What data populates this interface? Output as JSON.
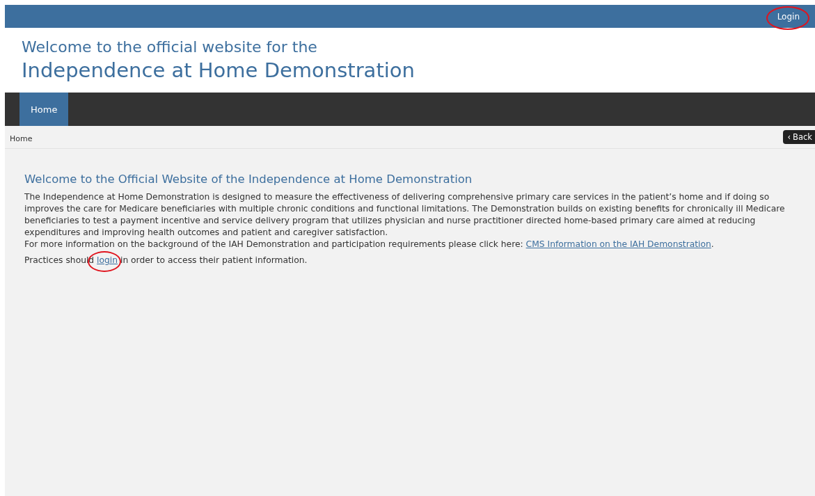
{
  "top_bar": {
    "login": {
      "label": "Login",
      "annotated": true
    }
  },
  "header": {
    "subtitle": "Welcome to the official website for the",
    "title": "Independence at Home Demonstration"
  },
  "nav": {
    "tabs": [
      {
        "label": "Home",
        "selected": true
      }
    ]
  },
  "breadcrumb": {
    "items": [
      "Home"
    ],
    "back": {
      "icon": "‹",
      "label": "Back"
    }
  },
  "content": {
    "heading": "Welcome to the Official Website of the Independence at Home Demonstration",
    "paragraphs": [
      {
        "lines": [
          [
            {
              "kind": "text",
              "text": "The Independence at Home Demonstration is designed to measure the effectiveness of delivering comprehensive primary care services in the patient’s home and if doing so improves the care for Medicare beneficiaries with multiple chronic conditions and functional limitations. The Demonstration builds on existing benefits for chronically ill Medicare beneficiaries to test a payment incentive and service delivery program that utilizes physician and nurse practitioner directed home-based primary care aimed at reducing expenditures and improving health outcomes and patient and caregiver satisfaction."
            }
          ],
          [
            {
              "kind": "text",
              "text": "For more information on the background of the IAH Demonstration and participation requirements please click here: "
            },
            {
              "kind": "link",
              "text": "CMS Information on the IAH Demonstration",
              "annotated": false
            },
            {
              "kind": "text",
              "text": "."
            }
          ]
        ]
      },
      {
        "lines": [
          [
            {
              "kind": "text",
              "text": "Practices should "
            },
            {
              "kind": "link",
              "text": "login",
              "annotated": true
            },
            {
              "kind": "text",
              "text": " in order to access their patient information."
            }
          ]
        ]
      }
    ]
  }
}
